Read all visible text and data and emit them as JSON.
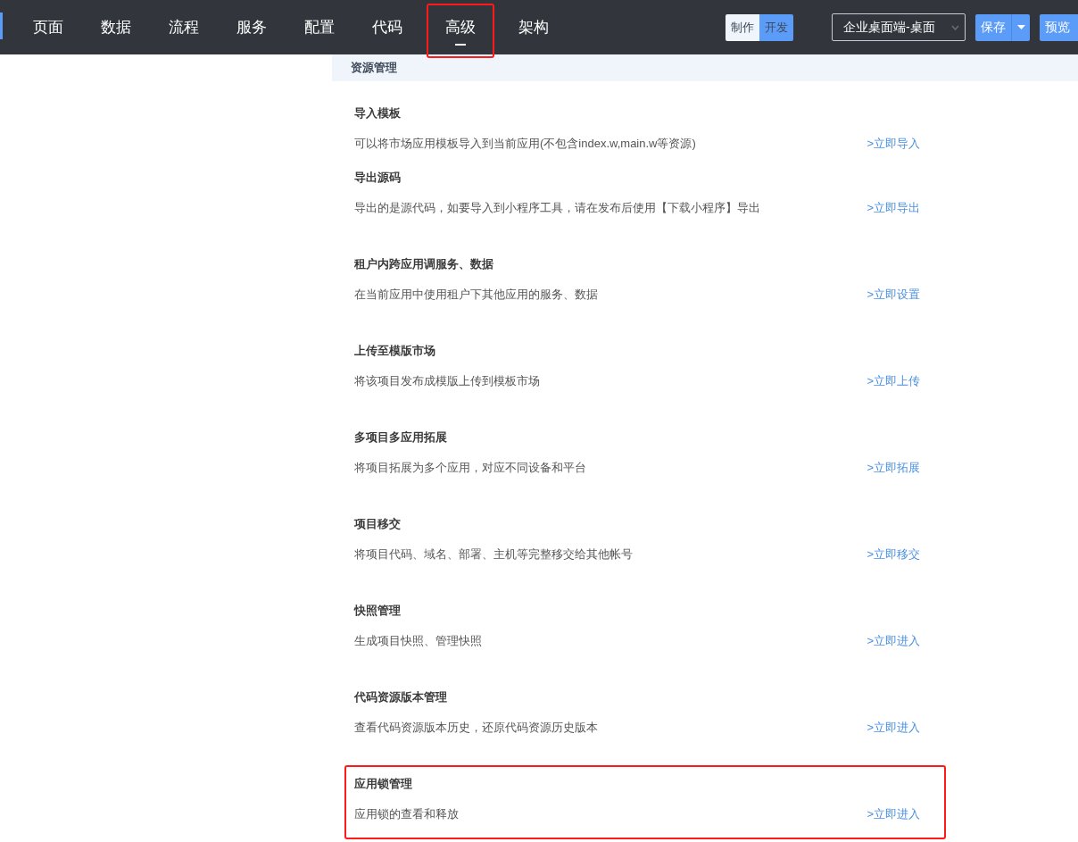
{
  "nav_tabs": [
    {
      "label": "页面",
      "selected": false,
      "highlighted": false
    },
    {
      "label": "数据",
      "selected": false,
      "highlighted": false
    },
    {
      "label": "流程",
      "selected": false,
      "highlighted": false
    },
    {
      "label": "服务",
      "selected": false,
      "highlighted": false
    },
    {
      "label": "配置",
      "selected": false,
      "highlighted": false
    },
    {
      "label": "代码",
      "selected": false,
      "highlighted": false
    },
    {
      "label": "高级",
      "selected": true,
      "highlighted": true
    },
    {
      "label": "架构",
      "selected": false,
      "highlighted": false
    }
  ],
  "mode_toggle": [
    {
      "label": "制作",
      "selected": false
    },
    {
      "label": "开发",
      "selected": true
    }
  ],
  "target_select": {
    "value": "企业桌面端-桌面"
  },
  "save_button": "保存",
  "preview_button": "预览",
  "panel_title": "资源管理",
  "sections": [
    {
      "title": "导入模板",
      "description": "可以将市场应用模板导入到当前应用(不包含index.w,main.w等资源)",
      "link": ">立即导入",
      "highlighted": false
    },
    {
      "title": "导出源码",
      "description": "导出的是源代码，如要导入到小程序工具，请在发布后使用【下载小程序】导出",
      "link": ">立即导出",
      "highlighted": false
    },
    {
      "title": "租户内跨应用调服务、数据",
      "description": "在当前应用中使用租户下其他应用的服务、数据",
      "link": ">立即设置",
      "highlighted": false
    },
    {
      "title": "上传至模版市场",
      "description": "将该项目发布成模版上传到模板市场",
      "link": ">立即上传",
      "highlighted": false
    },
    {
      "title": "多项目多应用拓展",
      "description": "将项目拓展为多个应用，对应不同设备和平台",
      "link": ">立即拓展",
      "highlighted": false
    },
    {
      "title": "项目移交",
      "description": "将项目代码、域名、部署、主机等完整移交给其他帐号",
      "link": ">立即移交",
      "highlighted": false
    },
    {
      "title": "快照管理",
      "description": "生成项目快照、管理快照",
      "link": ">立即进入",
      "highlighted": false
    },
    {
      "title": "代码资源版本管理",
      "description": "查看代码资源版本历史，还原代码资源历史版本",
      "link": ">立即进入",
      "highlighted": false
    },
    {
      "title": "应用锁管理",
      "description": "应用锁的查看和释放",
      "link": ">立即进入",
      "highlighted": true
    }
  ]
}
